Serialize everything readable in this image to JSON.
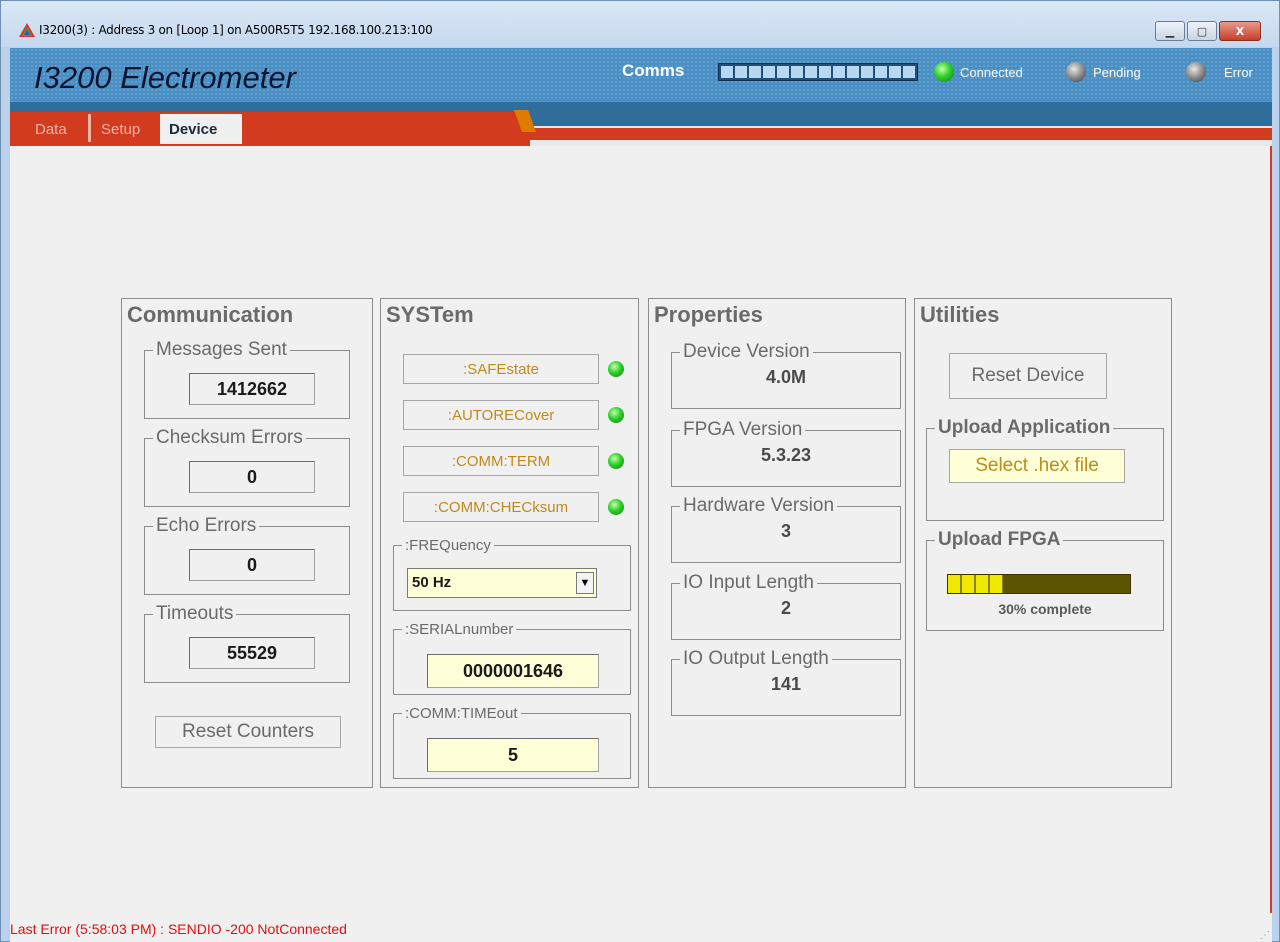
{
  "window": {
    "title": "I3200(3) : Address 3 on [Loop 1] on A500R5T5 192.168.100.213:100",
    "buttons": {
      "minimize": "▁",
      "maximize": "▢",
      "close": "X"
    }
  },
  "header": {
    "app_title": "I3200 Electrometer",
    "comms_label": "Comms",
    "comms_segments": 14,
    "status": [
      {
        "label": "Connected",
        "state": "on",
        "color": "#2bd02b"
      },
      {
        "label": "Pending",
        "state": "off",
        "color": "#8a8a8a"
      },
      {
        "label": "Error",
        "state": "off",
        "color": "#8a8a8a"
      }
    ]
  },
  "tabs": [
    {
      "label": "Data",
      "active": false
    },
    {
      "label": "Setup",
      "active": false
    },
    {
      "label": "Device",
      "active": true
    }
  ],
  "communication": {
    "title": "Communication",
    "messages_sent": {
      "label": "Messages Sent",
      "value": "1412662"
    },
    "checksum_errors": {
      "label": "Checksum Errors",
      "value": "0"
    },
    "echo_errors": {
      "label": "Echo Errors",
      "value": "0"
    },
    "timeouts": {
      "label": "Timeouts",
      "value": "55529"
    },
    "reset_button": "Reset Counters"
  },
  "system": {
    "title": "SYSTem",
    "commands": [
      {
        "label": ":SAFEstate",
        "led": "green"
      },
      {
        "label": ":AUTORECover",
        "led": "green"
      },
      {
        "label": ":COMM:TERM",
        "led": "green"
      },
      {
        "label": ":COMM:CHECksum",
        "led": "green"
      }
    ],
    "frequency": {
      "label": ":FREQuency",
      "value": "50 Hz"
    },
    "serial": {
      "label": ":SERIALnumber",
      "value": "0000001646"
    },
    "timeout": {
      "label": ":COMM:TIMEout",
      "value": "5"
    }
  },
  "properties": {
    "title": "Properties",
    "device_version": {
      "label": "Device Version",
      "value": "4.0M"
    },
    "fpga_version": {
      "label": "FPGA Version",
      "value": "5.3.23"
    },
    "hardware_version": {
      "label": "Hardware Version",
      "value": "3"
    },
    "io_input_length": {
      "label": "IO Input Length",
      "value": "2"
    },
    "io_output_length": {
      "label": "IO Output Length",
      "value": "141"
    }
  },
  "utilities": {
    "title": "Utilities",
    "reset_device": "Reset Device",
    "upload_application": {
      "label": "Upload Application",
      "button": "Select .hex file"
    },
    "upload_fpga": {
      "label": "Upload FPGA",
      "progress": 0.3,
      "progress_text": "30% complete"
    }
  },
  "statusbar": {
    "last_error": "Last Error (5:58:03 PM) :  SENDIO -200 NotConnected"
  }
}
